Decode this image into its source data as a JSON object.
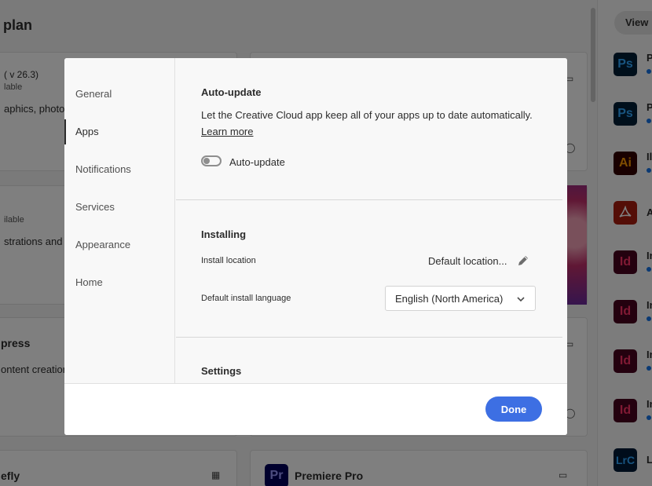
{
  "background": {
    "page_title": "plan",
    "cards": [
      {
        "version": "( v 26.3)",
        "status": "lable",
        "desc": "aphics, photos"
      },
      {
        "status": "ilable",
        "desc": "strations and g"
      },
      {
        "name": "press",
        "desc": "ontent creation"
      },
      {
        "name": "efly"
      },
      {
        "name": "Premiere Pro",
        "icon_text": "Pr"
      }
    ],
    "view_button": "View",
    "apps_list": [
      {
        "icon_text": "Ps",
        "label": "P"
      },
      {
        "icon_text": "Ps",
        "label": "P"
      },
      {
        "icon_text": "Ai",
        "label": "Il"
      },
      {
        "icon_text": "acrobat-icon",
        "label": "A"
      },
      {
        "icon_text": "Id",
        "label": "In"
      },
      {
        "icon_text": "Id",
        "label": "In"
      },
      {
        "icon_text": "Id",
        "label": "In"
      },
      {
        "icon_text": "Id",
        "label": "In"
      },
      {
        "icon_text": "LrC",
        "label": "L"
      }
    ]
  },
  "modal": {
    "nav": [
      {
        "label": "General",
        "active": false
      },
      {
        "label": "Apps",
        "active": true
      },
      {
        "label": "Notifications",
        "active": false
      },
      {
        "label": "Services",
        "active": false
      },
      {
        "label": "Appearance",
        "active": false
      },
      {
        "label": "Home",
        "active": false
      }
    ],
    "auto_update": {
      "title": "Auto-update",
      "description": "Let the Creative Cloud app keep all of your apps up to date automatically.",
      "learn_more": "Learn more",
      "toggle_label": "Auto-update",
      "toggle_on": false
    },
    "installing": {
      "title": "Installing",
      "install_location_label": "Install location",
      "install_location_value": "Default location...",
      "language_label": "Default install language",
      "language_value": "English (North America)"
    },
    "settings": {
      "title": "Settings"
    },
    "done_label": "Done"
  },
  "colors": {
    "primary_button": "#3d6fe3",
    "overlay": "rgba(0,0,0,0.5)",
    "ps_tile": "#001e36",
    "ps_text": "#31a8ff",
    "ai_tile": "#330000",
    "ai_text": "#ff9a00",
    "id_tile": "#49021f",
    "id_text": "#ff3366",
    "lrc_tile": "#001a36",
    "lrc_text": "#31a8ff",
    "acrobat_tile": "#a81c0f"
  }
}
